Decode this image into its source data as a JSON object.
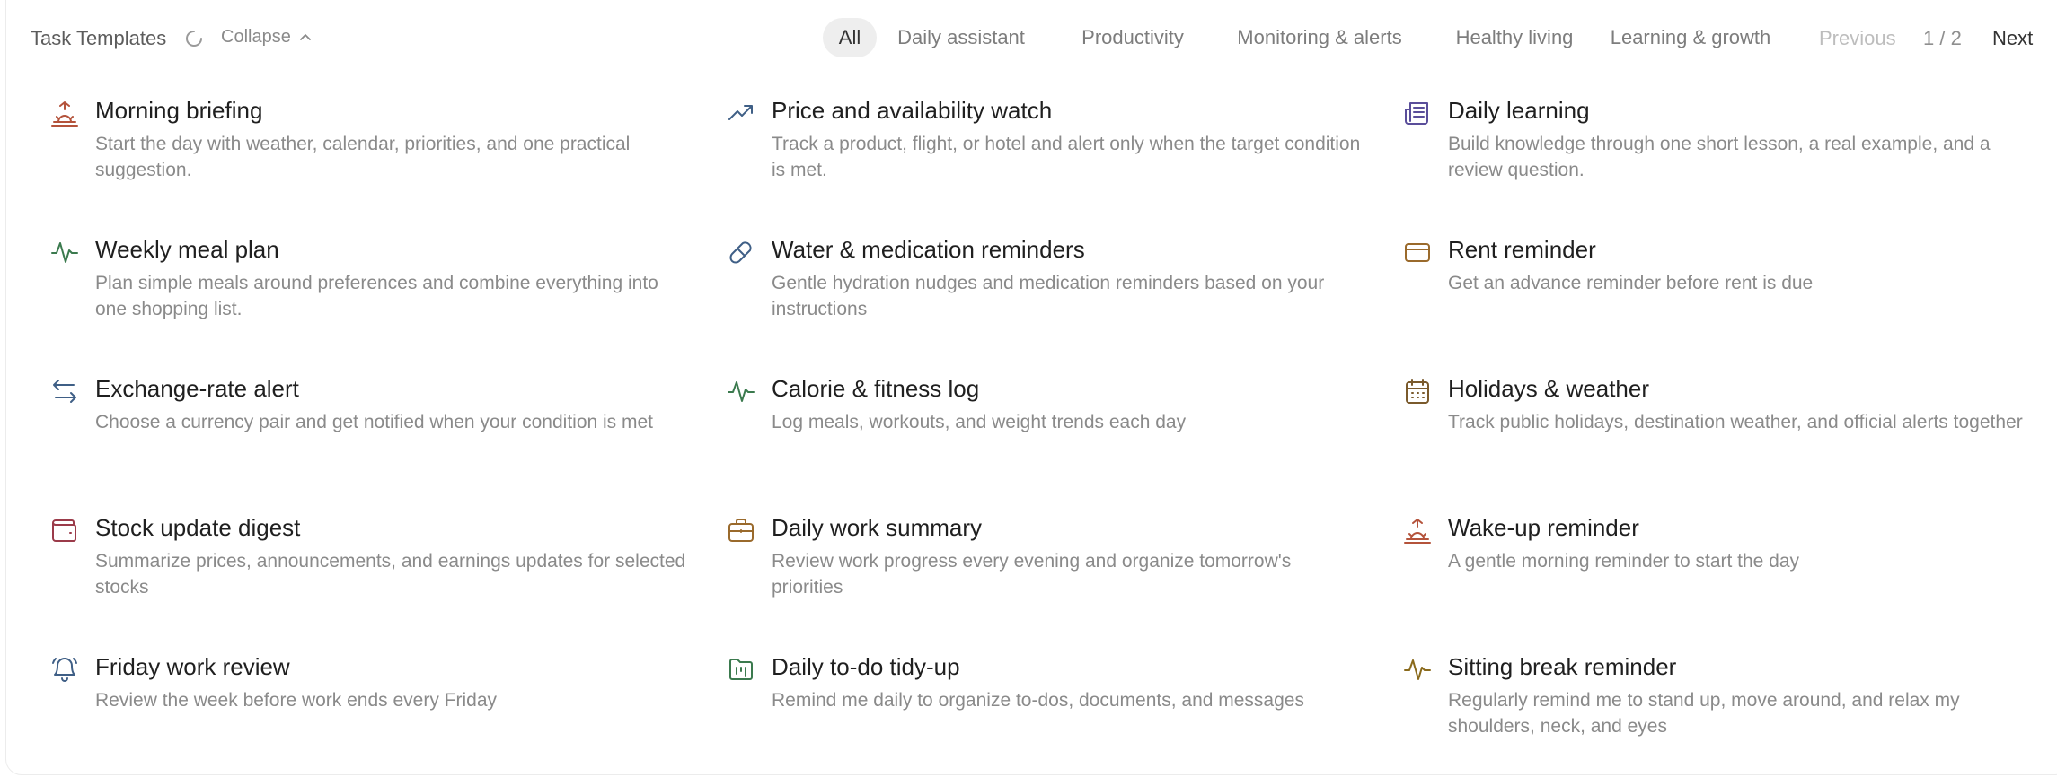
{
  "header": {
    "title": "Task Templates",
    "collapse_label": "Collapse",
    "tabs": [
      "All",
      "Daily assistant",
      "Productivity",
      "Monitoring & alerts",
      "Healthy living",
      "Learning & growth"
    ],
    "active_tab": "All",
    "previous_label": "Previous",
    "page_info": "1 / 2",
    "next_label": "Next"
  },
  "templates": [
    {
      "title": "Morning briefing",
      "desc": "Start the day with weather, calendar, priorities, and one practical suggestion.",
      "icon": "sunrise-icon",
      "color": "#b4533b"
    },
    {
      "title": "Price and availability watch",
      "desc": "Track a product, flight, or hotel and alert only when the target condition is met.",
      "icon": "trending-up-icon",
      "color": "#3f5f86"
    },
    {
      "title": "Daily learning",
      "desc": "Build knowledge through one short lesson, a real example, and a review question.",
      "icon": "newspaper-icon",
      "color": "#5a4e9a"
    },
    {
      "title": "Weekly meal plan",
      "desc": "Plan simple meals around preferences and combine everything into one shopping list.",
      "icon": "activity-icon",
      "color": "#3b7a4e"
    },
    {
      "title": "Water & medication reminders",
      "desc": "Gentle hydration nudges and medication reminders based on your instructions",
      "icon": "pill-icon",
      "color": "#3f5f86"
    },
    {
      "title": "Rent reminder",
      "desc": "Get an advance reminder before rent is due",
      "icon": "credit-card-icon",
      "color": "#9a6a2c"
    },
    {
      "title": "Exchange-rate alert",
      "desc": "Choose a currency pair and get notified when your condition is met",
      "icon": "arrows-exchange-icon",
      "color": "#3f5f86"
    },
    {
      "title": "Calorie & fitness log",
      "desc": "Log meals, workouts, and weight trends each day",
      "icon": "activity-icon",
      "color": "#3b7a4e"
    },
    {
      "title": "Holidays & weather",
      "desc": "Track public holidays, destination weather, and official alerts together",
      "icon": "calendar-icon",
      "color": "#7a5a2c"
    },
    {
      "title": "Stock update digest",
      "desc": "Summarize prices, announcements, and earnings updates for selected stocks",
      "icon": "wallet-icon",
      "color": "#9b3b4a"
    },
    {
      "title": "Daily work summary",
      "desc": "Review work progress every evening and organize tomorrow's priorities",
      "icon": "briefcase-icon",
      "color": "#9a6a2c"
    },
    {
      "title": "Wake-up reminder",
      "desc": "A gentle morning reminder to start the day",
      "icon": "sunrise-icon",
      "color": "#b4533b"
    },
    {
      "title": "Friday work review",
      "desc": "Review the week before work ends every Friday",
      "icon": "bell-ring-icon",
      "color": "#3f5f86"
    },
    {
      "title": "Daily to-do tidy-up",
      "desc": "Remind me daily to organize to-dos, documents, and messages",
      "icon": "folder-kanban-icon",
      "color": "#3b7a4e"
    },
    {
      "title": "Sitting break reminder",
      "desc": "Regularly remind me to stand up, move around, and relax my shoulders, neck, and eyes",
      "icon": "activity-icon",
      "color": "#8a6a1c"
    }
  ]
}
